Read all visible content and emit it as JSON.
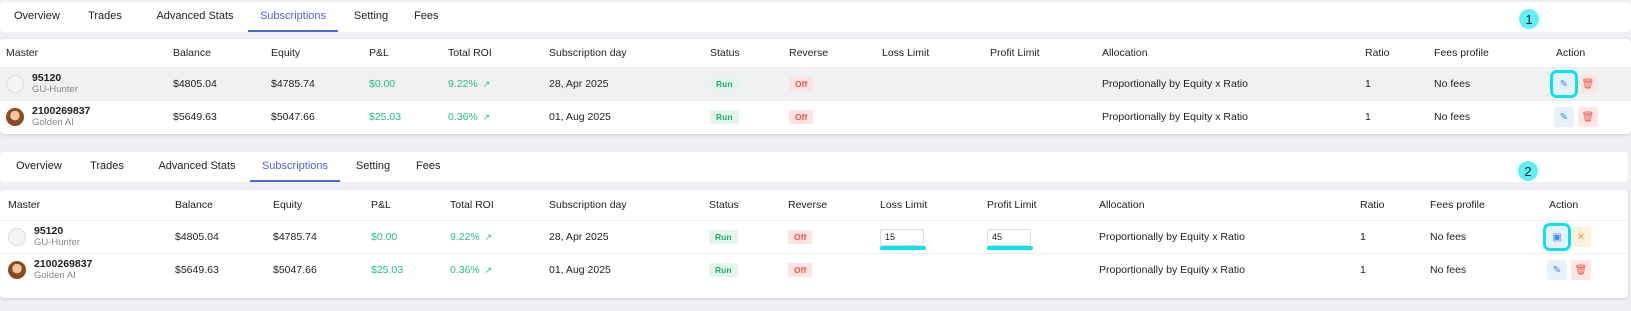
{
  "tabs": [
    "Overview",
    "Trades",
    "Advanced Stats",
    "Subscriptions",
    "Setting",
    "Fees"
  ],
  "active_tab": "Subscriptions",
  "columns": [
    "Master",
    "Balance",
    "Equity",
    "P&L",
    "Total ROI",
    "Subscription day",
    "Status",
    "Reverse",
    "Loss Limit",
    "Profit Limit",
    "Allocation",
    "Ratio",
    "Fees profile",
    "Action"
  ],
  "markers": [
    "1",
    "2"
  ],
  "panel1": {
    "rows": [
      {
        "id": "95120",
        "name": "GU-Hunter",
        "balance": "$4805.04",
        "equity": "$4785.74",
        "pnl": "$0.00",
        "roi": "9.22%",
        "day": "28, Apr 2025",
        "status": "Run",
        "reverse": "Off",
        "loss_limit": "",
        "profit_limit": "",
        "allocation": "Proportionally by Equity x Ratio",
        "ratio": "1",
        "fees": "No fees"
      },
      {
        "id": "2100269837",
        "name": "Golden AI",
        "balance": "$5649.63",
        "equity": "$5047.66",
        "pnl": "$25.03",
        "roi": "0.36%",
        "day": "01, Aug 2025",
        "status": "Run",
        "reverse": "Off",
        "loss_limit": "",
        "profit_limit": "",
        "allocation": "Proportionally by Equity x Ratio",
        "ratio": "1",
        "fees": "No fees"
      }
    ]
  },
  "panel2": {
    "rows": [
      {
        "id": "95120",
        "name": "GU-Hunter",
        "balance": "$4805.04",
        "equity": "$4785.74",
        "pnl": "$0.00",
        "roi": "9.22%",
        "day": "28, Apr 2025",
        "status": "Run",
        "reverse": "Off",
        "loss_limit_value": "15",
        "profit_limit_value": "45",
        "allocation": "Proportionally by Equity x Ratio",
        "ratio": "1",
        "fees": "No fees"
      },
      {
        "id": "2100269837",
        "name": "Golden AI",
        "balance": "$5649.63",
        "equity": "$5047.66",
        "pnl": "$25.03",
        "roi": "0.36%",
        "day": "01, Aug 2025",
        "status": "Run",
        "reverse": "Off",
        "loss_limit": "",
        "profit_limit": "",
        "allocation": "Proportionally by Equity x Ratio",
        "ratio": "1",
        "fees": "No fees"
      }
    ]
  },
  "colors": {
    "accent": "#4a67d6",
    "positive": "#22c08a",
    "highlight": "#00e5f0"
  },
  "icons": {
    "trend": "trend-up-icon",
    "edit": "pencil-icon",
    "delete": "trash-icon",
    "save": "save-icon",
    "cancel": "close-icon"
  }
}
